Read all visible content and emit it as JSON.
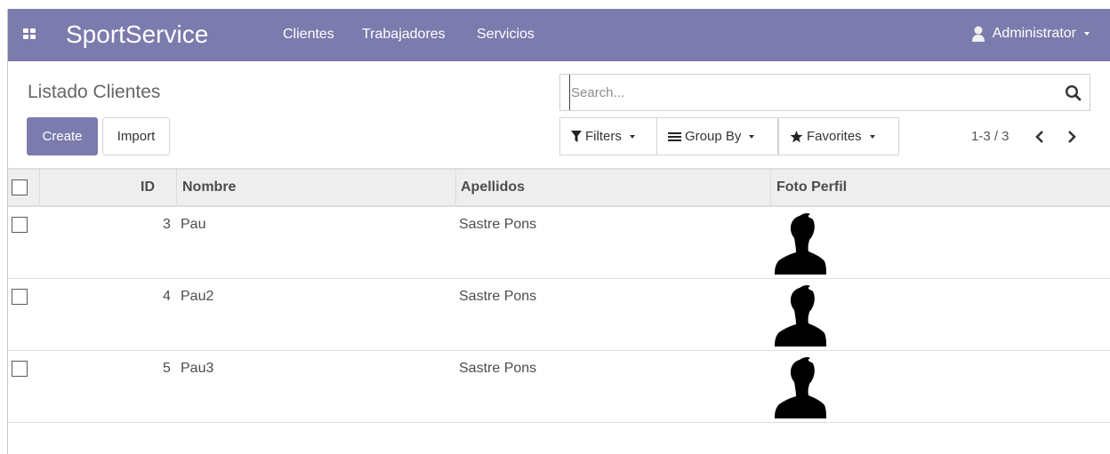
{
  "navbar": {
    "brand": "SportService",
    "menu": [
      "Clientes",
      "Trabajadores",
      "Servicios"
    ],
    "user": "Administrator",
    "bg_color": "#7c7bad"
  },
  "control_panel": {
    "title": "Listado Clientes",
    "create_label": "Create",
    "import_label": "Import",
    "search_placeholder": "Search...",
    "filters_label": "Filters",
    "group_by_label": "Group By",
    "favorites_label": "Favorites",
    "pager_value": "1-3 / 3"
  },
  "table": {
    "columns": [
      "ID",
      "Nombre",
      "Apellidos",
      "Foto Perfil"
    ],
    "rows": [
      {
        "id": "3",
        "nombre": "Pau",
        "apellidos": "Sastre Pons",
        "foto": "avatar-placeholder-icon"
      },
      {
        "id": "4",
        "nombre": "Pau2",
        "apellidos": "Sastre Pons",
        "foto": "avatar-placeholder-icon"
      },
      {
        "id": "5",
        "nombre": "Pau3",
        "apellidos": "Sastre Pons",
        "foto": "avatar-placeholder-icon"
      }
    ]
  }
}
